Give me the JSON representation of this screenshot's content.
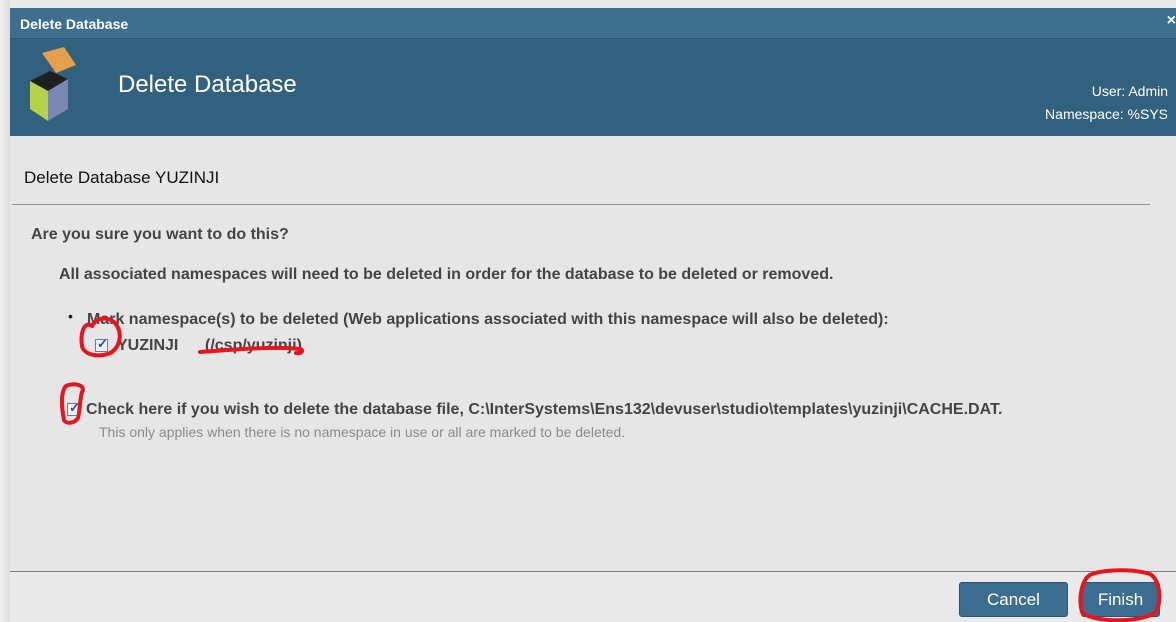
{
  "window": {
    "title": "Delete Database",
    "close_glyph": "×"
  },
  "header": {
    "title": "Delete Database",
    "user": "User: Admin",
    "namespace": "Namespace: %SYS",
    "logo_icon": "cube-logo-icon"
  },
  "content": {
    "subtitle": "Delete Database YUZINJI",
    "question": "Are you sure you want to do this?",
    "assoc_note": "All associated namespaces will need to be deleted in order for the database to be deleted or removed.",
    "bullet": "•",
    "mark_label": "Mark namespace(s) to be deleted (Web applications associated with this namespace will also be deleted):",
    "namespaces": [
      {
        "name": "YUZINJI",
        "path": "(/csp/yuzinji)",
        "checked": true
      }
    ],
    "delete_file": {
      "label": "Check here if you wish to delete the database file, C:\\InterSystems\\Ens132\\devuser\\studio\\templates\\yuzinji\\CACHE.DAT.",
      "hint": "This only applies when there is no namespace in use or all are marked to be deleted.",
      "checked": true
    }
  },
  "footer": {
    "cancel_label": "Cancel",
    "finish_label": "Finish"
  },
  "colors": {
    "header_bg": "#32617f",
    "titlebar_bg": "#3f6f8f",
    "button_bg": "#3d6d8f",
    "annotation_red": "#e8141e"
  }
}
